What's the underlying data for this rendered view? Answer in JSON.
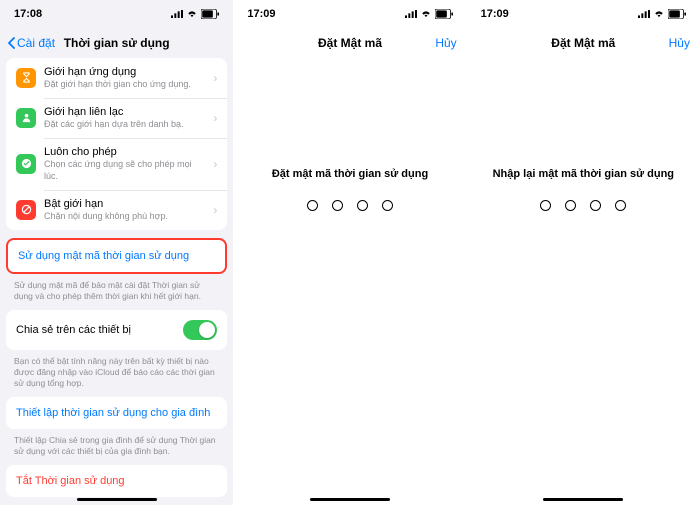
{
  "status": {
    "time1": "17:08",
    "time2": "17:09",
    "time3": "17:09"
  },
  "screen1": {
    "back": "Cài đặt",
    "title": "Thời gian sử dụng",
    "rows": [
      {
        "title": "Giới hạn ứng dụng",
        "sub": "Đặt giới hạn thời gian cho ứng dụng."
      },
      {
        "title": "Giới hạn liên lạc",
        "sub": "Đặt các giới hạn dựa trên danh bạ."
      },
      {
        "title": "Luôn cho phép",
        "sub": "Chọn các ứng dụng sẽ cho phép mọi lúc."
      },
      {
        "title": "Bật giới hạn",
        "sub": "Chặn nội dung không phù hợp."
      }
    ],
    "passcode_row": "Sử dụng mật mã thời gian sử dụng",
    "passcode_footer": "Sử dụng mật mã để bảo mật cài đặt Thời gian sử dụng và cho phép thêm thời gian khi hết giới hạn.",
    "share_row": "Chia sẻ trên các thiết bị",
    "share_footer": "Bạn có thể bật tính năng này trên bất kỳ thiết bị nào được đăng nhập vào iCloud để báo cáo các thời gian sử dụng tổng hợp.",
    "family_row": "Thiết lập thời gian sử dụng cho gia đình",
    "family_footer": "Thiết lập Chia sẻ trong gia đình để sử dụng Thời gian sử dụng với các thiết bị của gia đình bạn.",
    "off_row": "Tắt Thời gian sử dụng"
  },
  "screen2": {
    "title": "Đặt Mật mã",
    "cancel": "Hủy",
    "prompt": "Đặt mật mã thời gian sử dụng"
  },
  "screen3": {
    "title": "Đặt Mật mã",
    "cancel": "Hủy",
    "prompt": "Nhập lại mật mã thời gian sử dụng"
  },
  "colors": {
    "orange": "#ff9500",
    "green": "#34c759",
    "teal": "#30d158",
    "red": "#ff3b30"
  }
}
